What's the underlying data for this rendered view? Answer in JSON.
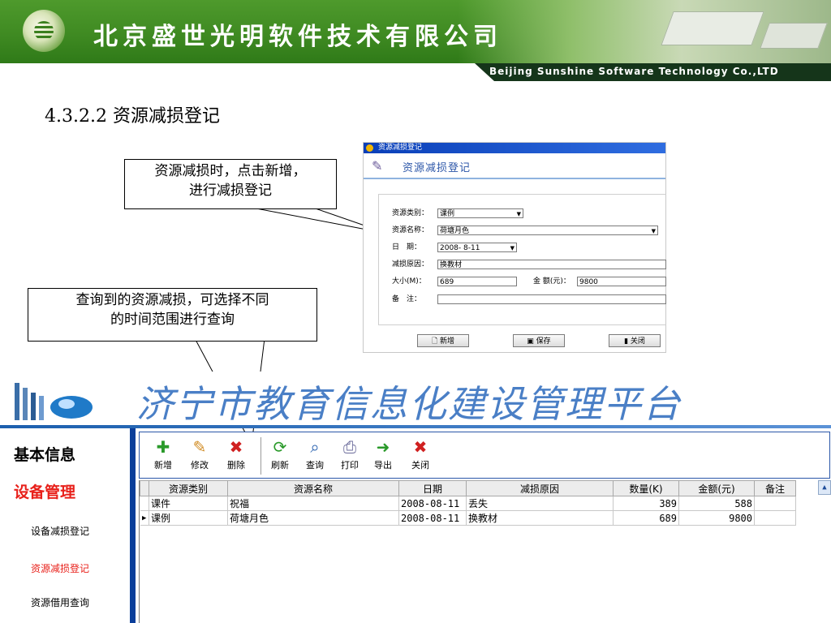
{
  "banner": {
    "company_cn": "北京盛世光明软件技术有限公司",
    "company_en": "Beijing Sunshine Software Technology Co.,LTD"
  },
  "section_heading": "4.3.2.2 资源减损登记",
  "callouts": {
    "new_entry": [
      "资源减损时，点击新增，",
      "进行减损登记"
    ],
    "query_range": [
      "查询到的资源减损，可选择不同",
      "的时间范围进行查询"
    ]
  },
  "dialog": {
    "window_title": "资源减损登记",
    "header_title": "资源减损登记",
    "fields": {
      "category_label": "资源类别：",
      "category_value": "课例",
      "name_label": "资源名称：",
      "name_value": "荷塘月色",
      "date_label": "日　期：",
      "date_value": "2008- 8-11",
      "reason_label": "减损原因：",
      "reason_value": "换教材",
      "size_label": "大小(M)：",
      "size_value": "689",
      "amount_label": "金 额(元)：",
      "amount_value": "9800",
      "remark_label": "备　注：",
      "remark_value": ""
    },
    "buttons": {
      "new": "新增",
      "save": "保存",
      "close": "关闭"
    }
  },
  "platform": {
    "title": "济宁市教育信息化建设管理平台"
  },
  "nav": {
    "sections": [
      "基本信息",
      "设备管理"
    ],
    "items": [
      "设备减损登记",
      "资源减损登记",
      "资源借用查询"
    ],
    "active_item": "资源减损登记",
    "active_color": "#e8201a",
    "section_active_color": "#e8201a"
  },
  "toolbar": {
    "buttons": [
      {
        "label": "新增",
        "icon": "add-icon"
      },
      {
        "label": "修改",
        "icon": "edit-icon"
      },
      {
        "label": "删除",
        "icon": "delete-icon"
      },
      {
        "label": "刷新",
        "icon": "refresh-icon"
      },
      {
        "label": "查询",
        "icon": "search-icon"
      },
      {
        "label": "打印",
        "icon": "print-icon"
      },
      {
        "label": "导出",
        "icon": "export-icon"
      },
      {
        "label": "关闭",
        "icon": "close-icon"
      }
    ]
  },
  "grid": {
    "columns": [
      "资源类别",
      "资源名称",
      "日期",
      "减损原因",
      "数量(K)",
      "金额(元)",
      "备注"
    ],
    "rows": [
      [
        "课件",
        "祝福",
        "2008-08-11",
        "丢失",
        "389",
        "588",
        ""
      ],
      [
        "课例",
        "荷塘月色",
        "2008-08-11",
        "换教材",
        "689",
        "9800",
        ""
      ]
    ],
    "current_row": 1
  }
}
